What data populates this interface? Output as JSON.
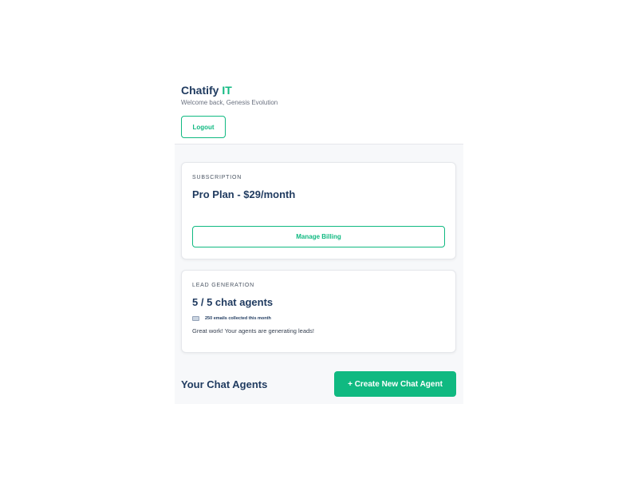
{
  "header": {
    "brand_main": "Chatify",
    "brand_accent": "IT",
    "welcome": "Welcome back, Genesis Evolution",
    "logout_label": "Logout"
  },
  "subscription": {
    "label": "SUBSCRIPTION",
    "plan": "Pro Plan - $29/month",
    "manage_label": "Manage Billing"
  },
  "lead_generation": {
    "label": "LEAD GENERATION",
    "agents": "5 / 5 chat agents",
    "emails_icon": "envelope-icon",
    "emails_text": "250 emails collected this month",
    "message": "Great work! Your agents are generating leads!"
  },
  "agents_section": {
    "title": "Your Chat Agents",
    "create_label": "+ Create New Chat Agent"
  },
  "colors": {
    "accent": "#10b981",
    "heading": "#1f3a5f",
    "background": "#f7f8fa"
  }
}
